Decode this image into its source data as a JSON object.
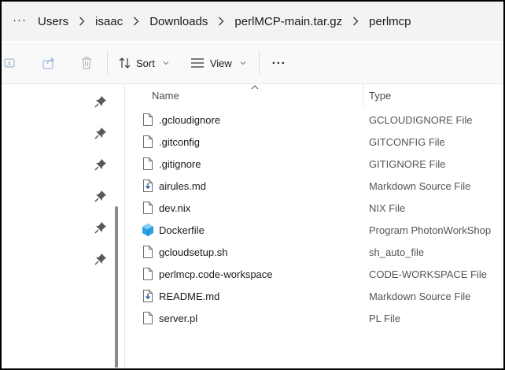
{
  "breadcrumb": {
    "more_label": "···",
    "items": [
      "Users",
      "isaac",
      "Downloads",
      "perlMCP-main.tar.gz",
      "perlmcp"
    ]
  },
  "toolbar": {
    "sort_label": "Sort",
    "view_label": "View",
    "more_label": "···"
  },
  "columns": {
    "name": "Name",
    "type": "Type"
  },
  "files": [
    {
      "name": ".gcloudignore",
      "type": "GCLOUDIGNORE File",
      "icon": "blank-file-icon"
    },
    {
      "name": ".gitconfig",
      "type": "GITCONFIG File",
      "icon": "blank-file-icon"
    },
    {
      "name": ".gitignore",
      "type": "GITIGNORE File",
      "icon": "blank-file-icon"
    },
    {
      "name": "airules.md",
      "type": "Markdown Source File",
      "icon": "markdown-file-icon"
    },
    {
      "name": "dev.nix",
      "type": "NIX File",
      "icon": "blank-file-icon"
    },
    {
      "name": "Dockerfile",
      "type": "Program PhotonWorkShop",
      "icon": "cube-file-icon"
    },
    {
      "name": "gcloudsetup.sh",
      "type": "sh_auto_file",
      "icon": "blank-file-icon"
    },
    {
      "name": "perlmcp.code-workspace",
      "type": "CODE-WORKSPACE File",
      "icon": "blank-file-icon"
    },
    {
      "name": "README.md",
      "type": "Markdown Source File",
      "icon": "markdown-file-icon"
    },
    {
      "name": "server.pl",
      "type": "PL File",
      "icon": "blank-file-icon"
    }
  ],
  "colors": {
    "accent": "#0067c0",
    "cube": "#2ba3e0"
  }
}
